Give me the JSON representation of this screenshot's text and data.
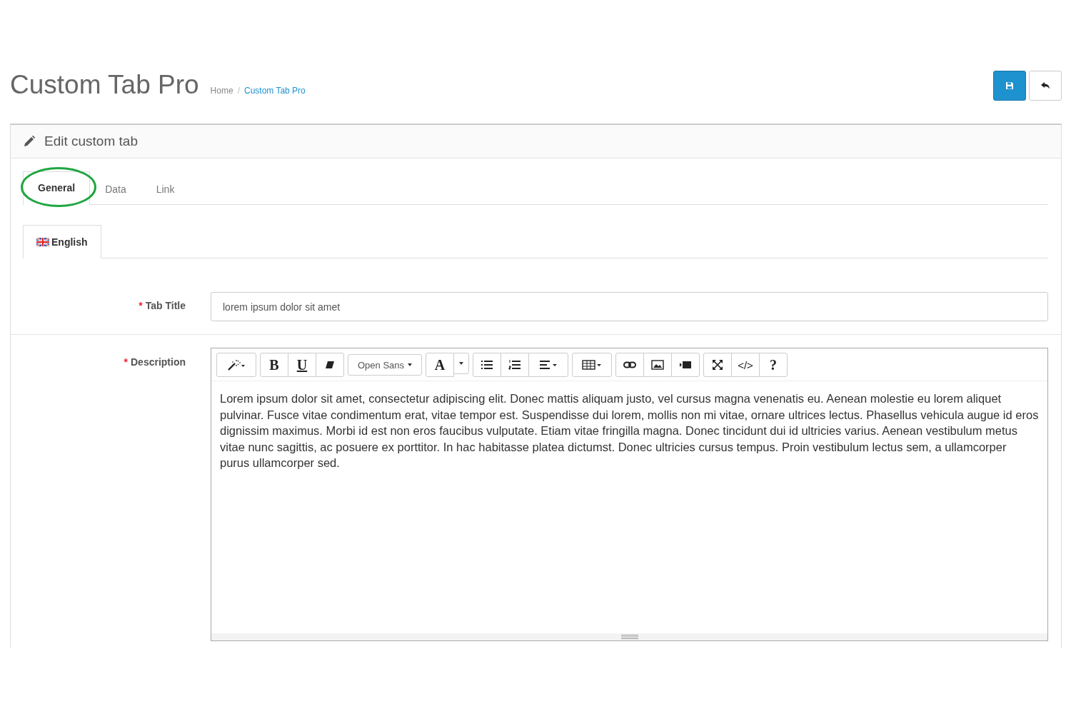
{
  "page_title": "Custom Tab Pro",
  "breadcrumb": {
    "separator": "/",
    "items": [
      {
        "label": "Home",
        "selected": false
      },
      {
        "label": "Custom Tab Pro",
        "selected": true
      }
    ]
  },
  "header_buttons": [
    {
      "kind": "save"
    },
    {
      "kind": "back"
    }
  ],
  "panel": {
    "title": "Edit custom tab",
    "tabs": [
      {
        "label": "General",
        "selected": true,
        "highlighted": true
      },
      {
        "label": "Data",
        "selected": false,
        "highlighted": false
      },
      {
        "label": "Link",
        "selected": false,
        "highlighted": false
      }
    ],
    "languages": [
      {
        "label": "English",
        "selected": true
      }
    ],
    "fields": [
      {
        "label": "Tab Title",
        "required_mark": "*",
        "kind": "text",
        "value": "lorem ipsum dolor sit amet"
      },
      {
        "label": "Description",
        "required_mark": "*",
        "kind": "editor",
        "toolbar": [
          [
            {
              "kind": "wand"
            }
          ],
          [
            {
              "kind": "bold",
              "label": "B"
            },
            {
              "kind": "underline",
              "label": "U"
            },
            {
              "kind": "eraser"
            }
          ],
          [
            {
              "kind": "font",
              "label": "Open Sans"
            }
          ],
          [
            {
              "kind": "color",
              "label": "A"
            },
            {
              "kind": "caret"
            }
          ],
          [
            {
              "kind": "ul"
            },
            {
              "kind": "ol"
            },
            {
              "kind": "align"
            }
          ],
          [
            {
              "kind": "table"
            }
          ],
          [
            {
              "kind": "link"
            },
            {
              "kind": "image"
            },
            {
              "kind": "video"
            }
          ],
          [
            {
              "kind": "fullscreen"
            },
            {
              "kind": "code",
              "label": "</>"
            },
            {
              "kind": "help",
              "label": "?"
            }
          ]
        ],
        "value": "Lorem ipsum dolor sit amet, consectetur adipiscing elit. Donec mattis aliquam justo, vel cursus magna venenatis eu. Aenean molestie eu lorem aliquet pulvinar. Fusce vitae condimentum erat, vitae tempor est. Suspendisse dui lorem, mollis non mi vitae, ornare ultrices lectus. Phasellus vehicula augue id eros dignissim maximus. Morbi id est non eros faucibus vulputate. Etiam vitae fringilla magna. Donec tincidunt dui id ultricies varius. Aenean vestibulum metus vitae nunc sagittis, ac posuere ex porttitor. In hac habitasse platea dictumst. Donec ultricies cursus tempus. Proin vestibulum lectus sem, a ullamcorper purus ullamcorper sed."
      }
    ]
  }
}
